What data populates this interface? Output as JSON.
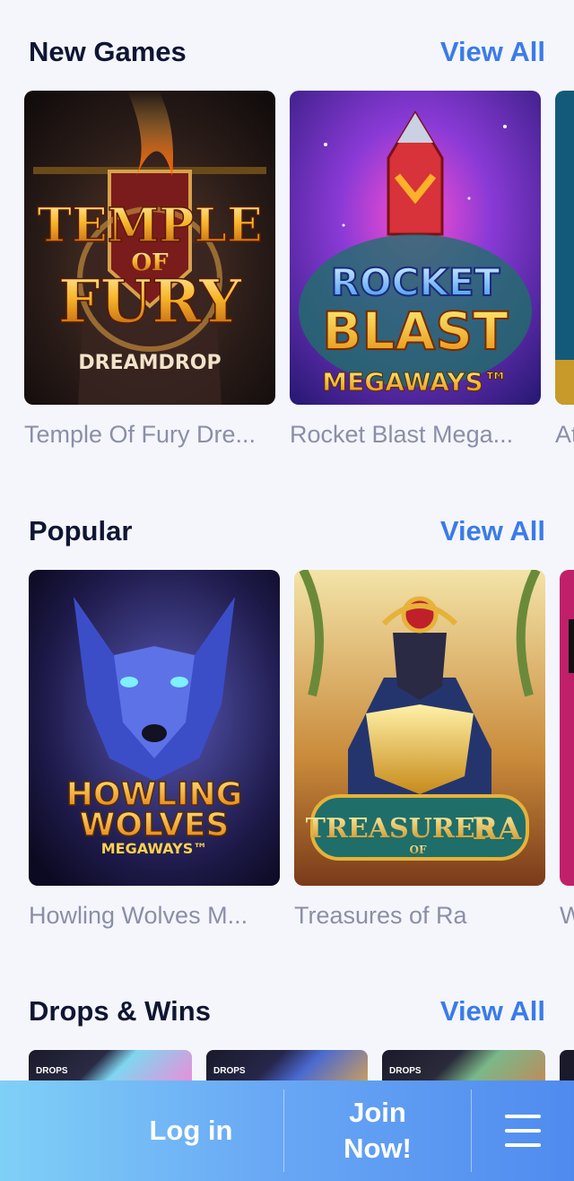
{
  "sections": {
    "new_games": {
      "title": "New Games",
      "view_all": "View All",
      "games": [
        {
          "name": "Temple Of Fury Dre...",
          "logo_line1": "TEMPLE",
          "logo_line2": "OF",
          "logo_line3": "FURY",
          "logo_line4": "DREAMDROP"
        },
        {
          "name": "Rocket Blast Mega...",
          "logo_line1": "ROCKET",
          "logo_line2": "BLAST",
          "logo_line3": "MEGAWAYS™"
        },
        {
          "name": "At..."
        }
      ]
    },
    "popular": {
      "title": "Popular",
      "view_all": "View All",
      "games": [
        {
          "name": "Howling Wolves M...",
          "logo_line1": "HOWLING",
          "logo_line2": "WOLVES",
          "logo_line3": "MEGAWAYS™"
        },
        {
          "name": "Treasures of Ra",
          "logo_line1": "TREASURES",
          "logo_line2": "OF",
          "logo_line3": "RA"
        },
        {
          "name": "W..."
        }
      ]
    },
    "drops_wins": {
      "title": "Drops & Wins",
      "view_all": "View All",
      "badge": "DROPS"
    }
  },
  "bottom_bar": {
    "login": "Log in",
    "join_line1": "Join",
    "join_line2": "Now!",
    "menu_icon": "hamburger-menu-icon"
  },
  "colors": {
    "background": "#f5f6fc",
    "title": "#0f1633",
    "accent": "#3b7be8",
    "muted": "#8a8fa8"
  }
}
